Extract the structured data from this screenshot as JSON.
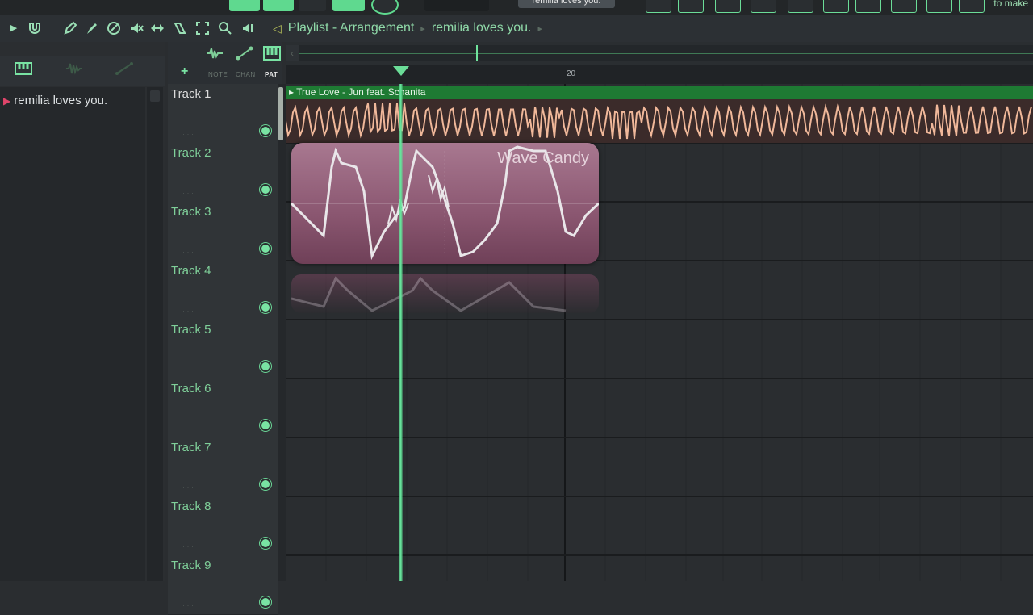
{
  "topbar": {
    "pattern_field": "remilia loves you.",
    "right_text": "to make"
  },
  "toolbar": {
    "breadcrumb": {
      "window": "Playlist - Arrangement",
      "arrangement": "remilia loves you."
    }
  },
  "browser": {
    "tabs": [
      "piano-roll-icon",
      "waveform-icon",
      "automation-icon"
    ],
    "pattern_item": "remilia loves you."
  },
  "track_header": {
    "mini_labels": [
      "NOTE",
      "CHAN",
      "PAT"
    ],
    "add_label": "+"
  },
  "tracks": [
    {
      "name": "Track 1"
    },
    {
      "name": "Track 2"
    },
    {
      "name": "Track 3"
    },
    {
      "name": "Track 4"
    },
    {
      "name": "Track 5"
    },
    {
      "name": "Track 6"
    },
    {
      "name": "Track 7"
    },
    {
      "name": "Track 8"
    },
    {
      "name": "Track 9"
    }
  ],
  "timeline": {
    "bar_number": "20"
  },
  "audio_clip": {
    "title": "True Love - Jun feat. Schanita"
  },
  "plugin": {
    "title": "Wave Candy"
  },
  "colors": {
    "accent": "#6fe39c",
    "clip_header": "#1e7a33",
    "plugin": "#8a5670"
  }
}
